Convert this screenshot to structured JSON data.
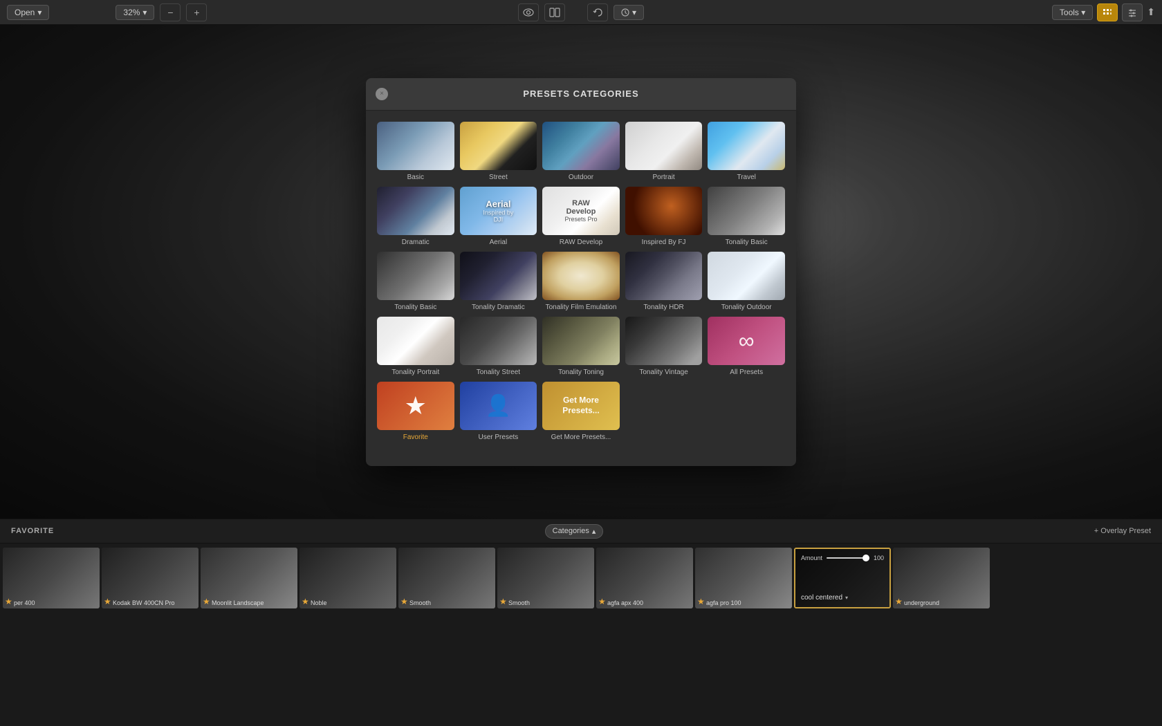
{
  "toolbar": {
    "open_label": "Open",
    "open_arrow": "▾",
    "zoom_value": "32%",
    "zoom_arrow": "▾",
    "zoom_minus": "−",
    "zoom_plus": "+",
    "eye_icon": "👁",
    "compare_icon": "⊡",
    "undo_icon": "↩",
    "history_icon": "🕐",
    "history_arrow": "▾",
    "tools_label": "Tools",
    "tools_arrow": "▾",
    "grid_icon": "▦",
    "sliders_icon": "⚙",
    "export_icon": "⬆"
  },
  "modal": {
    "title": "PRESETS CATEGORIES",
    "close_label": "×",
    "presets": [
      {
        "id": "basic",
        "label": "Basic",
        "thumb_class": "thumb-basic"
      },
      {
        "id": "street",
        "label": "Street",
        "thumb_class": "thumb-street"
      },
      {
        "id": "outdoor",
        "label": "Outdoor",
        "thumb_class": "thumb-outdoor"
      },
      {
        "id": "portrait",
        "label": "Portrait",
        "thumb_class": "thumb-portrait"
      },
      {
        "id": "travel",
        "label": "Travel",
        "thumb_class": "thumb-travel"
      },
      {
        "id": "dramatic",
        "label": "Dramatic",
        "thumb_class": "thumb-dramatic"
      },
      {
        "id": "aerial",
        "label": "Aerial",
        "thumb_class": "thumb-aerial",
        "has_label": true,
        "label_title": "Aerial",
        "label_sub": "Inspired by DJI"
      },
      {
        "id": "raw-develop",
        "label": "RAW Develop",
        "thumb_class": "thumb-raw",
        "has_raw_label": true,
        "raw_title": "RAW Develop",
        "raw_sub": "Presets Pro"
      },
      {
        "id": "inspired-fj",
        "label": "Inspired By FJ",
        "thumb_class": "thumb-fj"
      },
      {
        "id": "tonality-basic-1",
        "label": "Tonality Basic",
        "thumb_class": "thumb-tonality-basic"
      },
      {
        "id": "tonality-basic-2",
        "label": "Tonality Basic",
        "thumb_class": "thumb-tonality-basic2"
      },
      {
        "id": "tonality-dramatic",
        "label": "Tonality Dramatic",
        "thumb_class": "thumb-tonality-dramatic"
      },
      {
        "id": "tonality-film",
        "label": "Tonality Film Emulation",
        "thumb_class": "thumb-tonality-film"
      },
      {
        "id": "tonality-hdr",
        "label": "Tonality HDR",
        "thumb_class": "thumb-tonality-hdr"
      },
      {
        "id": "tonality-outdoor",
        "label": "Tonality Outdoor",
        "thumb_class": "thumb-tonality-outdoor"
      },
      {
        "id": "tonality-portrait",
        "label": "Tonality Portrait",
        "thumb_class": "thumb-tonality-portrait"
      },
      {
        "id": "tonality-street",
        "label": "Tonality Street",
        "thumb_class": "thumb-tonality-street"
      },
      {
        "id": "tonality-toning",
        "label": "Tonality Toning",
        "thumb_class": "thumb-tonality-toning"
      },
      {
        "id": "tonality-vintage",
        "label": "Tonality Vintage",
        "thumb_class": "thumb-tonality-vintage"
      },
      {
        "id": "all-presets",
        "label": "All Presets",
        "thumb_class": "thumb-all-presets",
        "has_infinity": true
      },
      {
        "id": "favorite",
        "label": "Favorite",
        "thumb_class": "thumb-favorite",
        "has_star": true,
        "is_special": true
      },
      {
        "id": "user-presets",
        "label": "User Presets",
        "thumb_class": "thumb-user",
        "has_user": true
      },
      {
        "id": "get-more",
        "label": "Get More Presets...",
        "thumb_class": "thumb-get-more",
        "has_get_more": true
      }
    ]
  },
  "bottom_bar": {
    "label": "FAVORITE",
    "categories_label": "Categories",
    "overlay_label": "+ Overlay Preset"
  },
  "film_strip": {
    "items": [
      {
        "id": "per400",
        "label": "per 400",
        "has_star": true
      },
      {
        "id": "kodak-bw",
        "label": "Kodak BW 400CN Pro",
        "has_star": true
      },
      {
        "id": "moonlit",
        "label": "Moonlit Landscape",
        "has_star": true
      },
      {
        "id": "noble",
        "label": "Noble",
        "has_star": true
      },
      {
        "id": "smooth1",
        "label": "Smooth",
        "has_star": true
      },
      {
        "id": "smooth2",
        "label": "Smooth",
        "has_star": true
      },
      {
        "id": "agfa-apx",
        "label": "agfa apx 400",
        "has_star": true
      },
      {
        "id": "agfa-pro",
        "label": "agfa pro 100",
        "has_star": true
      },
      {
        "id": "cool-centered",
        "label": "cool centered",
        "has_star": false,
        "is_active": true,
        "amount": 100,
        "amount_pct": 100
      },
      {
        "id": "underground",
        "label": "underground",
        "has_star": true
      }
    ]
  }
}
